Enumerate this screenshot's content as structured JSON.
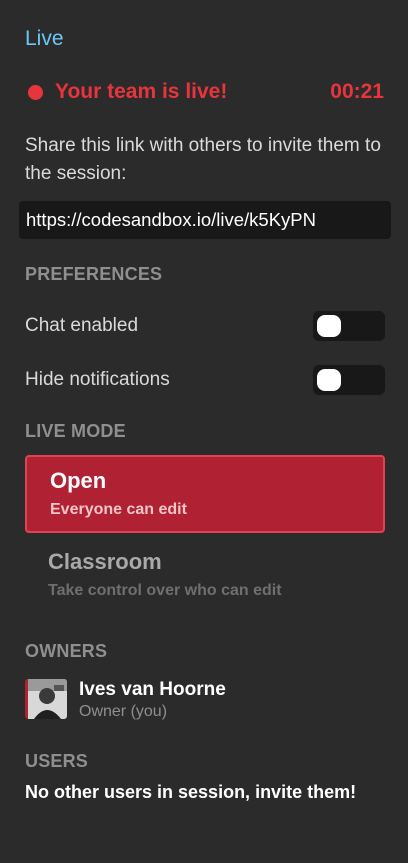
{
  "panel": {
    "title": "Live"
  },
  "status": {
    "live_text": "Your team is live!",
    "timer": "00:21",
    "live_color": "#e8343c"
  },
  "share": {
    "description": "Share this link with others to invite them to the session:",
    "link": "https://codesandbox.io/live/k5KyPN"
  },
  "preferences": {
    "heading": "PREFERENCES",
    "items": [
      {
        "label": "Chat enabled",
        "on": false
      },
      {
        "label": "Hide notifications",
        "on": false
      }
    ]
  },
  "live_mode": {
    "heading": "LIVE MODE",
    "options": [
      {
        "title": "Open",
        "subtitle": "Everyone can edit",
        "selected": true
      },
      {
        "title": "Classroom",
        "subtitle": "Take control over who can edit",
        "selected": false
      }
    ]
  },
  "owners": {
    "heading": "OWNERS",
    "list": [
      {
        "name": "Ives van Hoorne",
        "role": "Owner (you)"
      }
    ]
  },
  "users": {
    "heading": "USERS",
    "empty_text": "No other users in session, invite them!"
  },
  "colors": {
    "accent": "#6cc7f6",
    "active_mode": "#b02233",
    "background": "#2b2b2b"
  }
}
